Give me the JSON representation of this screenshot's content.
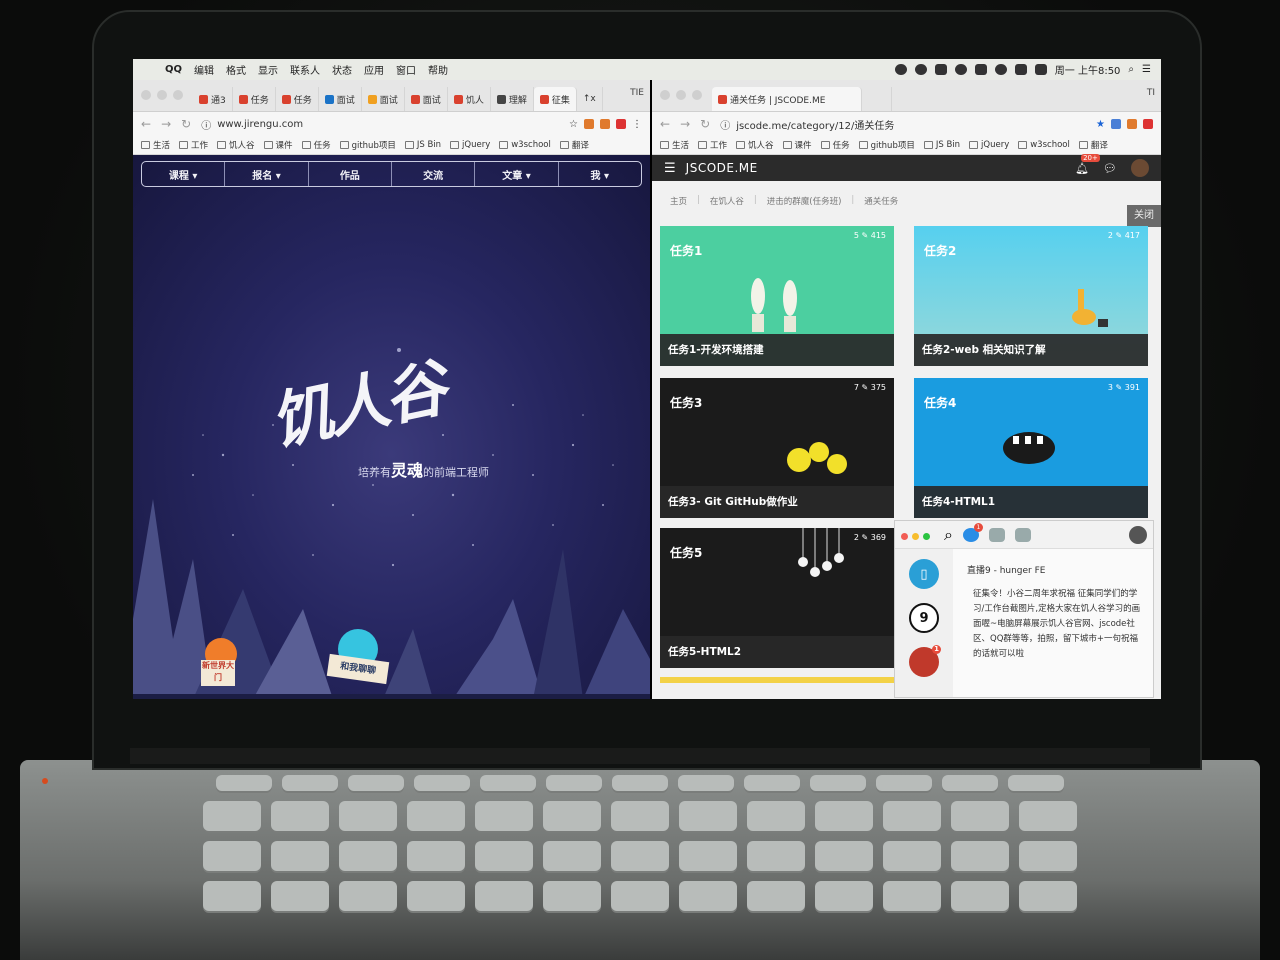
{
  "menubar": {
    "app_name": "QQ",
    "items": [
      "编辑",
      "格式",
      "显示",
      "联系人",
      "状态",
      "应用",
      "窗口",
      "帮助"
    ],
    "clock": "周一 上午8:50"
  },
  "left_browser": {
    "tabs": [
      "通3",
      "任务",
      "任务",
      "面试",
      "面试",
      "面试",
      "饥人",
      "理解",
      "征集",
      "↑x"
    ],
    "tab_extra": "TIE",
    "url": "www.jirengu.com",
    "bookmarks": [
      "生活",
      "工作",
      "饥人谷",
      "课件",
      "任务",
      "github项目",
      "JS Bin",
      "jQuery",
      "w3school",
      "翻译"
    ]
  },
  "jirengu": {
    "nav": [
      "课程 ▾",
      "报名 ▾",
      "作品",
      "交流",
      "文章 ▾",
      "我 ▾"
    ],
    "logo": "饥人谷",
    "tagline_pre": "培养有",
    "tagline_bold": "灵魂",
    "tagline_post": "的前端工程师",
    "btn_newworld": "新世界大门",
    "btn_chat": "和我聊聊"
  },
  "right_browser": {
    "tab_title": "通关任务 | JSCODE.ME",
    "tab_extra": "TI",
    "url": "jscode.me/category/12/通关任务",
    "bookmarks": [
      "生活",
      "工作",
      "饥人谷",
      "课件",
      "任务",
      "github项目",
      "JS Bin",
      "jQuery",
      "w3school",
      "翻译"
    ]
  },
  "jscode": {
    "brand": "JSCODE.ME",
    "notif_badge": "20+",
    "breadcrumb": [
      "主页",
      "在饥人谷",
      "进击的群魔(任务班)",
      "通关任务"
    ],
    "close_label": "关闭",
    "cards": [
      {
        "title": "任务1",
        "stats": "5 ✎ 415",
        "caption": "任务1-开发环境搭建"
      },
      {
        "title": "任务2",
        "stats": "2 ✎ 417",
        "caption": "任务2-web 相关知识了解"
      },
      {
        "title": "任务3",
        "stats": "7 ✎ 375",
        "caption": "任务3- Git GitHub做作业"
      },
      {
        "title": "任务4",
        "stats": "3 ✎ 391",
        "caption": "任务4-HTML1"
      },
      {
        "title": "任务5",
        "stats": "2 ✎ 369",
        "caption": "任务5-HTML2"
      }
    ]
  },
  "qq_panel": {
    "badge": "1",
    "side_badge": "1",
    "side_number": "9",
    "chat_title": "直播9 - hunger FE",
    "message": "征集令！小谷二周年求祝福 征集同学们的学习/工作台截图片,定格大家在饥人谷学习的画面喔~电脑屏幕展示饥人谷官网、jscode社区、QQ群等等，拍照，留下城市+一句祝福的话就可以啦"
  },
  "colors": {
    "jirengu_bg": "#262660",
    "card1": "#4ccfa0",
    "card2": "#56d0ef",
    "card4": "#1a9ce0",
    "card_dark": "#1b1b1b",
    "jscode_nav": "#2b2b2b"
  }
}
